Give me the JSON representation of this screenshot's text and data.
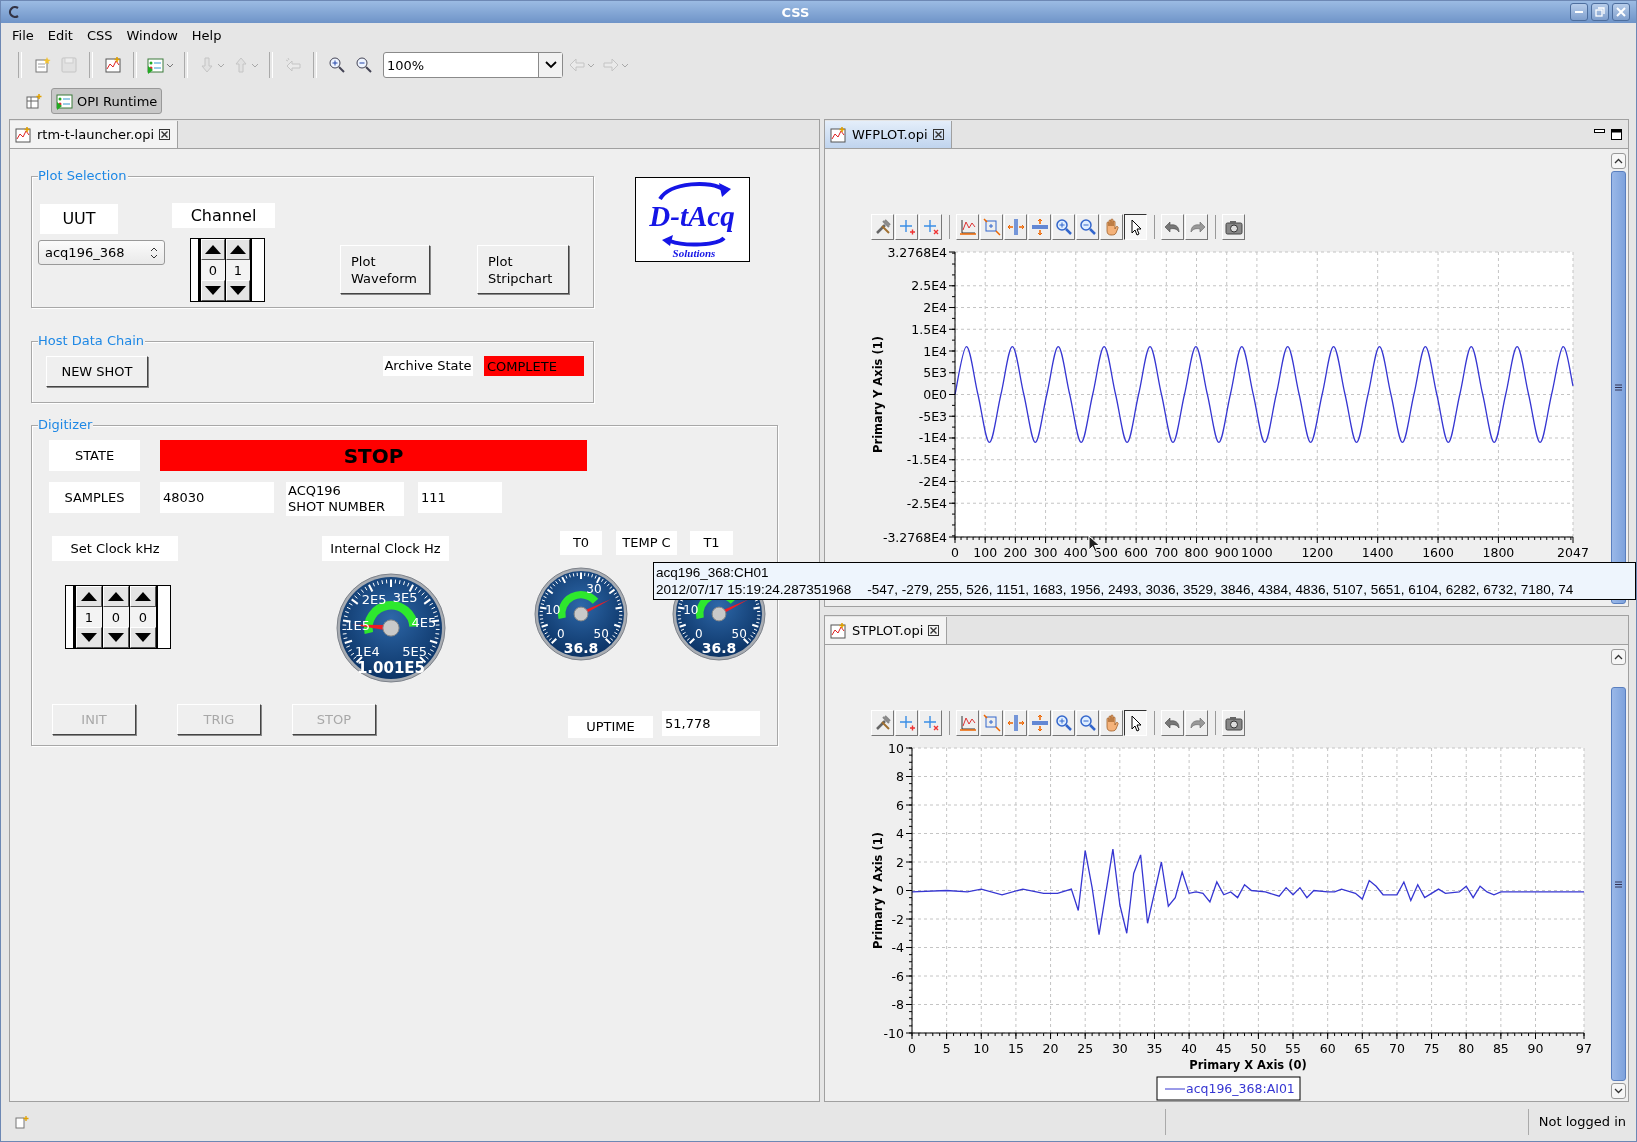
{
  "window": {
    "title": "CSS"
  },
  "menu": [
    {
      "label": "File"
    },
    {
      "label": "Edit"
    },
    {
      "label": "CSS"
    },
    {
      "label": "Window"
    },
    {
      "label": "Help"
    }
  ],
  "toolbar": [
    {
      "kind": "new",
      "disabled": false
    },
    {
      "kind": "save",
      "disabled": true
    },
    {
      "kind": "editor",
      "disabled": false
    },
    {
      "kind": "run",
      "disabled": false
    },
    {
      "kind": "next",
      "disabled": true
    },
    {
      "kind": "previous",
      "disabled": true
    },
    {
      "kind": "back-edit",
      "disabled": true
    },
    {
      "kind": "zoom-in",
      "disabled": false
    },
    {
      "kind": "zoom-out",
      "disabled": false
    },
    {
      "kind": "zoom",
      "value": "100%"
    },
    {
      "kind": "back",
      "disabled": true
    },
    {
      "kind": "forward",
      "disabled": true
    }
  ],
  "perspectives": [
    {
      "label": "OPI Runtime",
      "selected": true
    }
  ],
  "editor": {
    "tab": {
      "label": "rtm-t-launcher.opi",
      "selected": false
    },
    "plot_selection": {
      "title": "Plot Selection",
      "uut_label": "UUT",
      "uut_value": "acq196_368",
      "channel_label": "Channel",
      "channel_digits": [
        "0",
        "1"
      ],
      "buttons": [
        {
          "label": "Plot Waveform"
        },
        {
          "label": "Plot Stripchart"
        }
      ]
    },
    "logo": {
      "name": "D-tAcq",
      "tagline": "Solutions"
    },
    "host_data_chain": {
      "title": "Host Data Chain",
      "button": "NEW SHOT",
      "archive_label": "Archive State",
      "archive_state": {
        "value": "COMPLETE",
        "alarm": true
      }
    },
    "digitizer": {
      "title": "Digitizer",
      "state_label": "STATE",
      "state": {
        "value": "STOP",
        "alarm": true
      },
      "samples_label": "SAMPLES",
      "samples": "48030",
      "shot_label": [
        "ACQ196",
        "SHOT NUMBER"
      ],
      "shot": "111",
      "set_clock_label": "Set Clock kHz",
      "internal_clock_label": "Internal Clock Hz",
      "t0_label": "T0",
      "temp_label": "TEMP C",
      "t1_label": "T1",
      "clock_digits": [
        "1",
        "0",
        "0"
      ],
      "gauges": [
        {
          "readout": "1.001E5",
          "labels": [
            "2E5",
            "3E5",
            "1E5",
            "4E5",
            "1E4",
            "5E5"
          ]
        },
        {
          "readout": "36.8",
          "labels": [
            "30",
            "10",
            "0",
            "50"
          ]
        },
        {
          "readout": "36.8",
          "labels": [
            "10",
            "0",
            "50"
          ]
        }
      ],
      "buttons": [
        {
          "label": "INIT",
          "disabled": true
        },
        {
          "label": "TRIG",
          "disabled": true
        },
        {
          "label": "STOP",
          "disabled": true
        }
      ],
      "uptime_label": "UPTIME",
      "uptime": "51,778"
    }
  },
  "waveform_view": {
    "tab": {
      "label": "WFPLOT.opi",
      "selected": true
    },
    "plot_toolbar": [
      {
        "kind": "configure",
        "selected": false
      },
      {
        "kind": "add-annotation",
        "selected": false
      },
      {
        "kind": "remove-annotation",
        "selected": false
      },
      {
        "kind": "autoscale",
        "selected": false
      },
      {
        "kind": "rubberband-zoom",
        "selected": false
      },
      {
        "kind": "horizontal-zoom",
        "selected": false
      },
      {
        "kind": "vertical-zoom",
        "selected": false
      },
      {
        "kind": "zoom-in",
        "selected": false
      },
      {
        "kind": "zoom-out",
        "selected": false
      },
      {
        "kind": "pan",
        "selected": false
      },
      {
        "kind": "pointer",
        "selected": true
      },
      {
        "kind": "undo",
        "selected": false
      },
      {
        "kind": "redo",
        "selected": false
      },
      {
        "kind": "snapshot",
        "selected": false
      }
    ],
    "chart_data": {
      "type": "line",
      "grid": true,
      "ylabel": "Primary Y Axis (1)",
      "x": [
        0,
        38,
        76,
        114,
        152,
        190,
        228,
        266,
        304,
        342,
        380,
        418,
        456,
        494,
        532,
        570,
        608,
        646,
        684,
        722,
        760,
        798,
        836,
        874,
        912,
        950,
        988,
        1026,
        1064,
        1102,
        1140,
        1178,
        1216,
        1254,
        1292,
        1330,
        1368,
        1406,
        1444,
        1482,
        1520,
        1558,
        1596,
        1634,
        1672,
        1710,
        1748,
        1786,
        1824,
        1862,
        1900,
        1938,
        1976,
        2014,
        2047
      ],
      "series": [
        {
          "color": "#3636d2",
          "values": [
            0,
            11000,
            0,
            -11000,
            0,
            11000,
            0,
            -11000,
            0,
            11000,
            0,
            -11000,
            0,
            11000,
            0,
            -11000,
            0,
            11000,
            0,
            -11000,
            0,
            11000,
            0,
            -11000,
            0,
            11000,
            0,
            -11000,
            0,
            11000,
            0,
            -11000,
            0,
            11000,
            0,
            -11000,
            0,
            11000,
            0,
            -11000,
            0,
            11000,
            0,
            -11000,
            0,
            11000,
            0,
            -11000,
            0,
            11000,
            0,
            -11000,
            0,
            11000,
            2000
          ]
        }
      ],
      "xlim": [
        0,
        2047
      ],
      "ylim": [
        -32768,
        32768
      ],
      "xticks": [
        0,
        100,
        200,
        300,
        400,
        500,
        600,
        700,
        800,
        900,
        1000,
        1200,
        1400,
        1600,
        1800,
        2047
      ],
      "yticks": [
        {
          "value": 32768,
          "label": "3.2768E4"
        },
        {
          "value": 25000,
          "label": "2.5E4"
        },
        {
          "value": 20000,
          "label": "2E4"
        },
        {
          "value": 15000,
          "label": "1.5E4"
        },
        {
          "value": 10000,
          "label": "1E4"
        },
        {
          "value": 5000,
          "label": "5E3"
        },
        {
          "value": 0,
          "label": "0E0"
        },
        {
          "value": -5000,
          "label": "-5E3"
        },
        {
          "value": -10000,
          "label": "-1E4"
        },
        {
          "value": -15000,
          "label": "-1.5E4"
        },
        {
          "value": -20000,
          "label": "-2E4"
        },
        {
          "value": -25000,
          "label": "-2.5E4"
        },
        {
          "value": -32768,
          "label": "-3.2768E4"
        }
      ]
    }
  },
  "stripchart_view": {
    "tab": {
      "label": "STPLOT.opi",
      "selected": false
    },
    "plot_toolbar": [
      {
        "kind": "configure",
        "selected": false
      },
      {
        "kind": "add-annotation",
        "selected": false
      },
      {
        "kind": "remove-annotation",
        "selected": false
      },
      {
        "kind": "autoscale",
        "selected": false
      },
      {
        "kind": "rubberband-zoom",
        "selected": false
      },
      {
        "kind": "horizontal-zoom",
        "selected": false
      },
      {
        "kind": "vertical-zoom",
        "selected": false
      },
      {
        "kind": "zoom-in",
        "selected": false
      },
      {
        "kind": "zoom-out",
        "selected": false
      },
      {
        "kind": "pan",
        "selected": false
      },
      {
        "kind": "pointer",
        "selected": true
      },
      {
        "kind": "undo",
        "selected": false
      },
      {
        "kind": "redo",
        "selected": false
      },
      {
        "kind": "snapshot",
        "selected": false
      }
    ],
    "chart_data": {
      "type": "line",
      "grid": true,
      "xlabel": "Primary X Axis (0)",
      "ylabel": "Primary Y Axis (1)",
      "x": [
        0,
        5,
        8,
        10,
        13,
        16,
        19,
        21,
        23,
        24,
        25,
        26,
        27,
        29,
        30,
        31,
        32,
        33,
        34,
        36,
        37,
        38,
        39,
        40,
        41,
        42,
        43,
        44,
        45,
        46,
        47,
        48,
        49,
        51,
        53,
        54,
        55,
        56,
        57,
        58,
        60,
        61,
        62,
        64,
        65,
        66,
        67,
        68,
        70,
        71,
        72,
        73,
        74,
        75,
        76,
        77,
        79,
        80,
        81,
        82,
        83,
        84,
        85,
        97
      ],
      "series": [
        {
          "name": "acq196_368:AI01",
          "color": "#3636d2",
          "values": [
            -0.1,
            0,
            -0.1,
            0.1,
            -0.3,
            0.1,
            -0.2,
            -0.2,
            0.1,
            -1.4,
            2.8,
            0.2,
            -3.1,
            2.9,
            -1,
            -3,
            1.2,
            2.5,
            -2.3,
            2,
            -1.1,
            -0.5,
            1.3,
            -0.2,
            -0.1,
            -0.2,
            -0.8,
            0.6,
            -0.3,
            -0.1,
            -0.5,
            0.4,
            0,
            -0.1,
            -0.4,
            0.2,
            -0.3,
            0.2,
            -0.5,
            0,
            -0.1,
            -0.1,
            0.1,
            -0.2,
            -0.6,
            0.7,
            0.3,
            -0.3,
            -0.3,
            0.6,
            -0.7,
            0.4,
            -0.5,
            -0.2,
            0.1,
            -0.2,
            -0.1,
            0.3,
            -0.5,
            0.3,
            -0.1,
            -0.3,
            -0.1,
            -0.1
          ]
        }
      ],
      "xlim": [
        0,
        97
      ],
      "ylim": [
        -10,
        10
      ],
      "xticks": [
        0,
        5,
        10,
        15,
        20,
        25,
        30,
        35,
        40,
        45,
        50,
        55,
        60,
        65,
        70,
        75,
        80,
        85,
        90,
        97
      ],
      "yticks": [
        -10,
        -8,
        -6,
        -4,
        -2,
        0,
        2,
        4,
        6,
        8,
        10
      ]
    }
  },
  "tooltip": {
    "title": "acq196_368:CH01",
    "timestamp": "2012/07/17 15:19:24.287351968",
    "values": "-547, -279, 255, 526, 1151, 1683, 1956, 2493, 3036, 3529, 3846, 4384, 4836, 5107, 5651, 6104, 6282, 6732, 7180, 74"
  },
  "status_bar": {
    "login": "Not logged in"
  }
}
